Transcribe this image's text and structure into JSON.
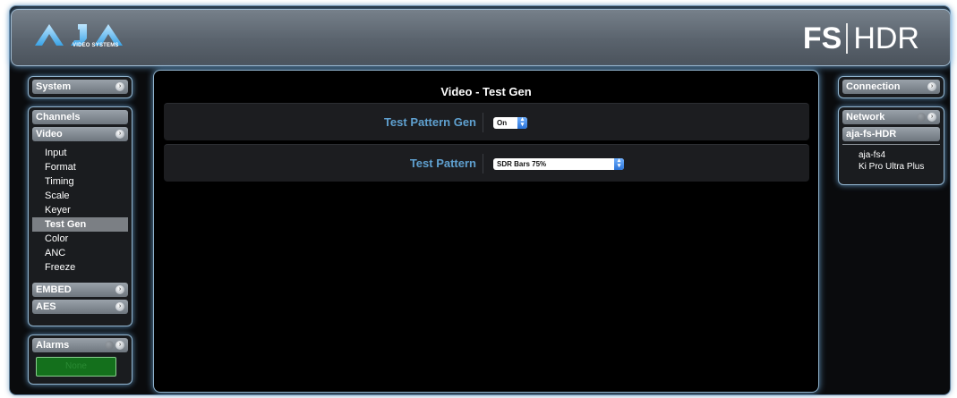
{
  "header": {
    "logo_text": "AJA",
    "logo_subtext": "VIDEO SYSTEMS",
    "product_brand": "FS",
    "product_model": "HDR"
  },
  "left_sidebar": {
    "system_label": "System",
    "channels_label": "Channels",
    "video_label": "Video",
    "video_items": [
      "Input",
      "Format",
      "Timing",
      "Scale",
      "Keyer",
      "Test Gen",
      "Color",
      "ANC",
      "Freeze"
    ],
    "active_item": "Test Gen",
    "embed_label": "EMBED",
    "aes_label": "AES",
    "alarms_label": "Alarms",
    "alarm_status": "None"
  },
  "main": {
    "title": "Video - Test Gen",
    "params": [
      {
        "label": "Test Pattern Gen",
        "value": "On"
      },
      {
        "label": "Test Pattern",
        "value": "SDR Bars 75%"
      }
    ]
  },
  "right_sidebar": {
    "connection_label": "Connection",
    "network_label": "Network",
    "current_device": "aja-fs-HDR",
    "other_devices": [
      "aja-fs4",
      "Ki Pro Ultra Plus"
    ]
  },
  "colors": {
    "accent_blue": "#5fa0cf",
    "panel_glow": "#92b5cf",
    "alarm_green": "#14701c"
  }
}
